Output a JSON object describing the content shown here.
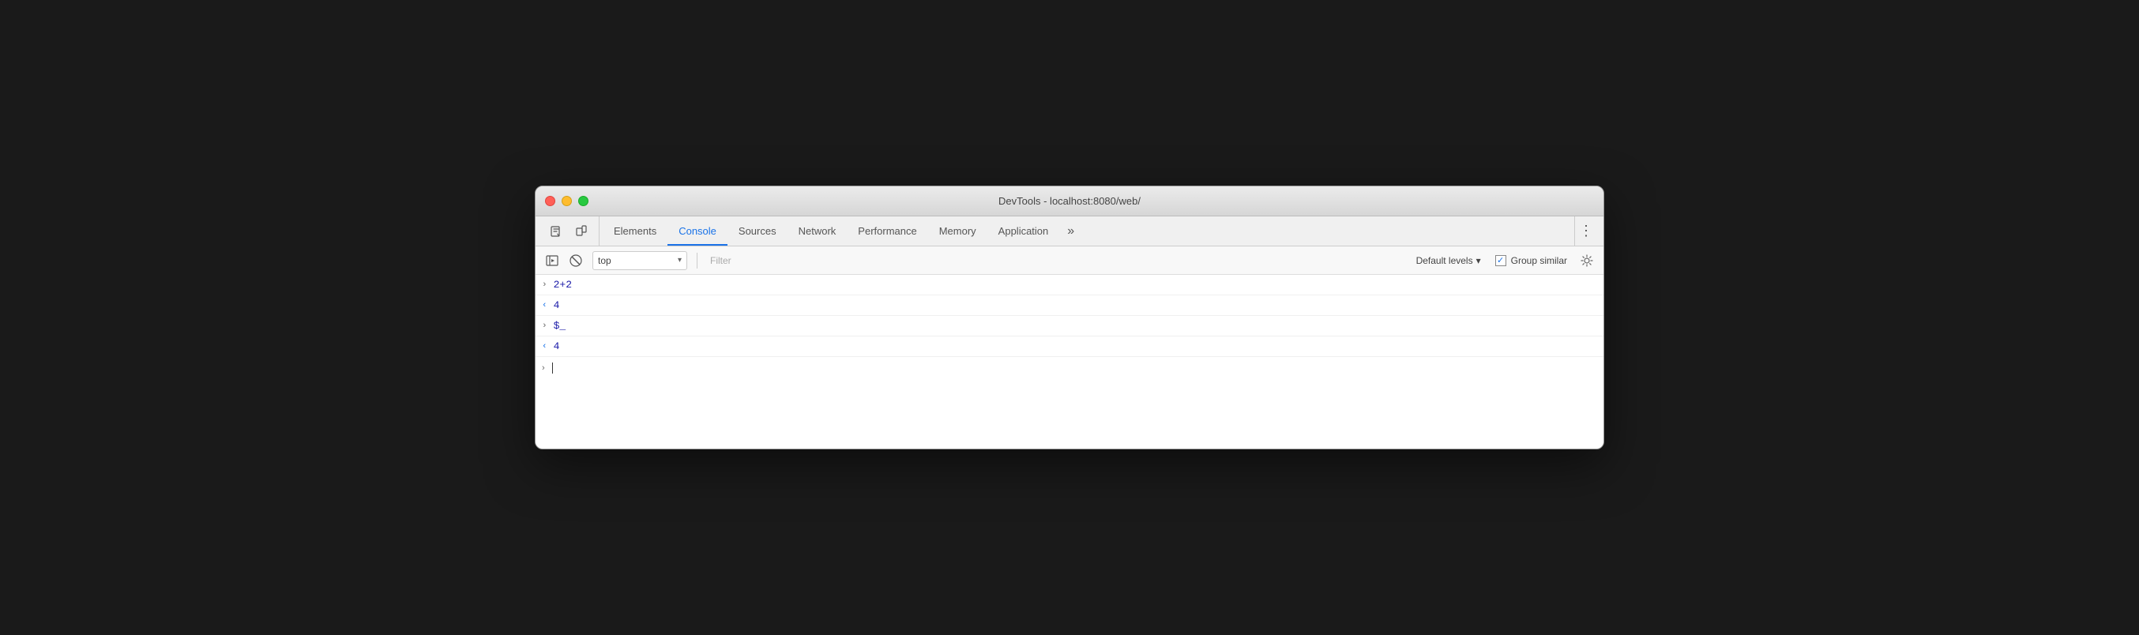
{
  "window": {
    "title": "DevTools - localhost:8080/web/"
  },
  "traffic_lights": {
    "close_label": "close",
    "minimize_label": "minimize",
    "maximize_label": "maximize"
  },
  "toolbar": {
    "inspect_icon": "⬛",
    "device_icon": "⬜"
  },
  "tabs": [
    {
      "id": "elements",
      "label": "Elements",
      "active": false
    },
    {
      "id": "console",
      "label": "Console",
      "active": true
    },
    {
      "id": "sources",
      "label": "Sources",
      "active": false
    },
    {
      "id": "network",
      "label": "Network",
      "active": false
    },
    {
      "id": "performance",
      "label": "Performance",
      "active": false
    },
    {
      "id": "memory",
      "label": "Memory",
      "active": false
    },
    {
      "id": "application",
      "label": "Application",
      "active": false
    }
  ],
  "tab_more_label": "»",
  "tab_bar_right_menu_icon": "⋮",
  "console_toolbar": {
    "sidebar_icon": "▶|",
    "clear_icon": "🚫",
    "top_select_value": "top",
    "top_select_dropdown": "▾",
    "filter_placeholder": "Filter",
    "default_levels_label": "Default levels",
    "default_levels_dropdown": "▾",
    "group_similar_label": "Group similar",
    "settings_icon": "⚙"
  },
  "console_entries": [
    {
      "type": "input",
      "text": "2+2"
    },
    {
      "type": "output",
      "text": "4"
    },
    {
      "type": "input",
      "text": "$_"
    },
    {
      "type": "output",
      "text": "4"
    }
  ],
  "colors": {
    "active_tab": "#1a73e8",
    "input_text": "#1a1aa8",
    "output_text": "#1a1aa8",
    "chevron_output": "#1a73e8"
  }
}
